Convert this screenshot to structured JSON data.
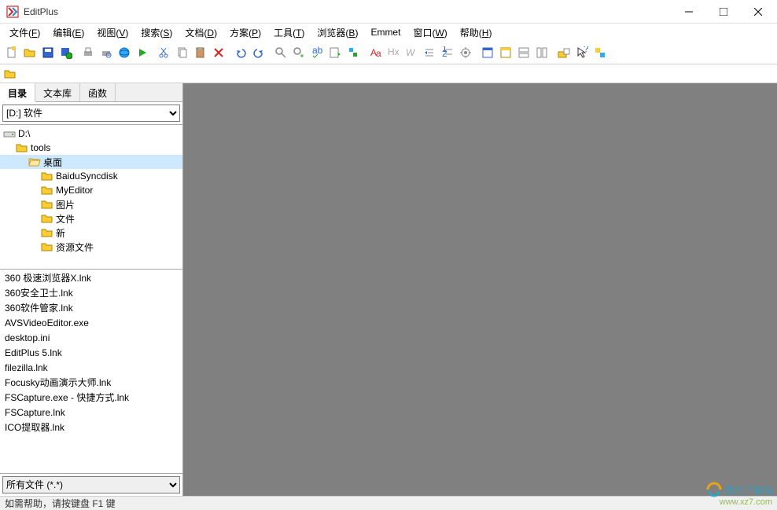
{
  "window": {
    "title": "EditPlus",
    "minimize": "—",
    "maximize": "☐",
    "close": "✕"
  },
  "menu": [
    {
      "label": "文件",
      "key": "F"
    },
    {
      "label": "编辑",
      "key": "E"
    },
    {
      "label": "视图",
      "key": "V"
    },
    {
      "label": "搜索",
      "key": "S"
    },
    {
      "label": "文档",
      "key": "D"
    },
    {
      "label": "方案",
      "key": "P"
    },
    {
      "label": "工具",
      "key": "T"
    },
    {
      "label": "浏览器",
      "key": "B"
    },
    {
      "label": "Emmet",
      "key": ""
    },
    {
      "label": "窗口",
      "key": "W"
    },
    {
      "label": "帮助",
      "key": "H"
    }
  ],
  "sidebar": {
    "tabs": [
      "目录",
      "文本库",
      "函数"
    ],
    "active_tab": 0,
    "drive_selected": "[D:] 软件",
    "tree": [
      {
        "label": "D:\\",
        "level": 0,
        "icon": "drive",
        "selected": false
      },
      {
        "label": "tools",
        "level": 1,
        "icon": "folder",
        "selected": false
      },
      {
        "label": "桌面",
        "level": 2,
        "icon": "folder-open",
        "selected": true
      },
      {
        "label": "BaiduSyncdisk",
        "level": 3,
        "icon": "folder",
        "selected": false
      },
      {
        "label": "MyEditor",
        "level": 3,
        "icon": "folder",
        "selected": false
      },
      {
        "label": "图片",
        "level": 3,
        "icon": "folder",
        "selected": false
      },
      {
        "label": "文件",
        "level": 3,
        "icon": "folder",
        "selected": false
      },
      {
        "label": "新",
        "level": 3,
        "icon": "folder",
        "selected": false
      },
      {
        "label": "资源文件",
        "level": 3,
        "icon": "folder",
        "selected": false
      }
    ],
    "files": [
      "360 极速浏览器X.lnk",
      "360安全卫士.lnk",
      "360软件管家.lnk",
      "AVSVideoEditor.exe",
      "desktop.ini",
      "EditPlus 5.lnk",
      "filezilla.lnk",
      "Focusky动画演示大师.lnk",
      "FSCapture.exe - 快捷方式.lnk",
      "FSCapture.lnk",
      "ICO提取器.lnk"
    ],
    "filter": "所有文件 (*.*)"
  },
  "statusbar": "如需帮助，请按键盘 F1 键",
  "watermark": {
    "brand": "极光下载站",
    "url": "www.xz7.com"
  }
}
